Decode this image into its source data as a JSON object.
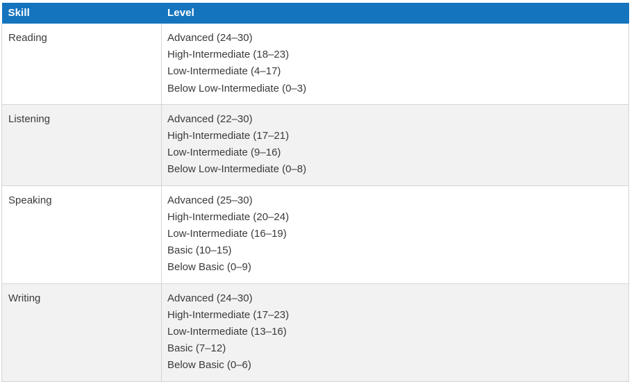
{
  "table": {
    "name": "skill-level-table",
    "colors": {
      "header_background": "#1574be",
      "header_text": "#ffffff",
      "row_stripe": "#f2f2f2",
      "row_plain": "#ffffff",
      "border": "#d5d5d5",
      "body_text": "#3a3a3a"
    },
    "columns": [
      {
        "key": "skill",
        "label": "Skill"
      },
      {
        "key": "level",
        "label": "Level"
      }
    ],
    "rows": [
      {
        "skill": "Reading",
        "levels": [
          "Advanced (24–30)",
          "High-Intermediate (18–23)",
          "Low-Intermediate (4–17)",
          "Below Low-Intermediate (0–3)"
        ]
      },
      {
        "skill": "Listening",
        "levels": [
          "Advanced (22–30)",
          "High-Intermediate (17–21)",
          "Low-Intermediate (9–16)",
          "Below Low-Intermediate (0–8)"
        ]
      },
      {
        "skill": "Speaking",
        "levels": [
          "Advanced (25–30)",
          "High-Intermediate (20–24)",
          "Low-Intermediate (16–19)",
          "Basic (10–15)",
          "Below Basic (0–9)"
        ]
      },
      {
        "skill": "Writing",
        "levels": [
          "Advanced (24–30)",
          "High-Intermediate (17–23)",
          "Low-Intermediate (13–16)",
          "Basic (7–12)",
          "Below Basic (0–6)"
        ]
      }
    ]
  }
}
